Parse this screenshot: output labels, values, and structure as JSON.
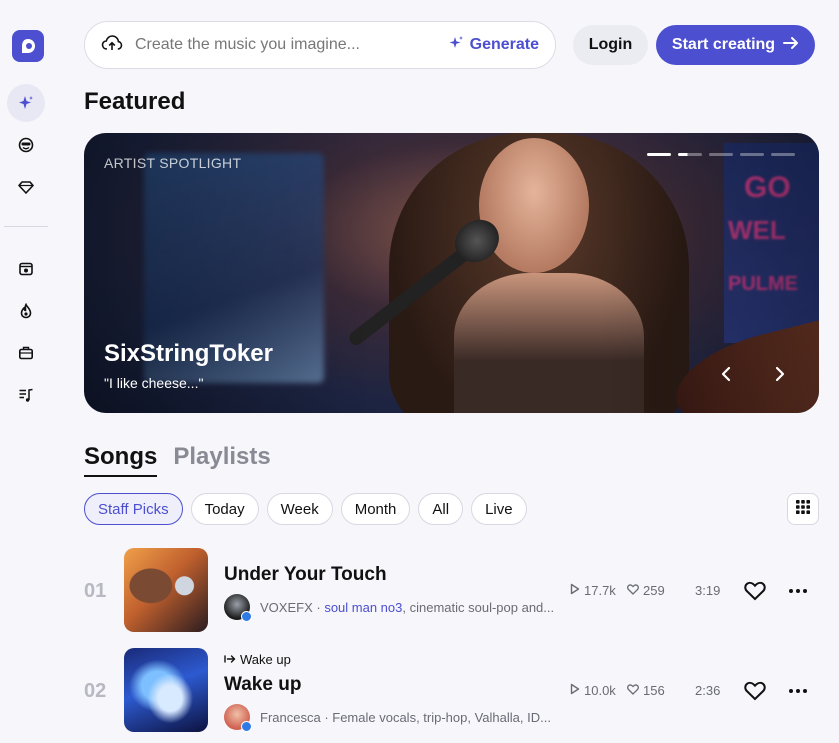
{
  "sidebar": {
    "logo_icon": "app-logo-icon",
    "items_top": [
      "sparkle-icon",
      "smiley-icon",
      "diamond-icon"
    ],
    "items_bottom": [
      "inbox-icon",
      "flame-icon",
      "briefcase-icon",
      "music-list-icon"
    ]
  },
  "search": {
    "placeholder": "Create the music you imagine...",
    "generate_label": "Generate"
  },
  "header": {
    "login_label": "Login",
    "start_label": "Start creating"
  },
  "featured": {
    "title": "Featured",
    "hero": {
      "label": "ARTIST SPOTLIGHT",
      "name": "SixStringToker",
      "quote": "\"I like cheese...\"",
      "slide_count": 5,
      "active_slide": 1
    }
  },
  "tabs": {
    "songs": "Songs",
    "playlists": "Playlists"
  },
  "filters": [
    "Staff Picks",
    "Today",
    "Week",
    "Month",
    "All",
    "Live"
  ],
  "songs": [
    {
      "rank": "01",
      "title": "Under Your Touch",
      "playlist_label": "",
      "artist": "VOXEFX",
      "artist_link": "soul man no3",
      "description": ", cinematic soul-pop and...",
      "plays": "17.7k",
      "likes": "259",
      "duration": "3:19"
    },
    {
      "rank": "02",
      "title": "Wake up",
      "playlist_label": "Wake up",
      "artist": "Francesca",
      "artist_link": "",
      "description": "Female vocals, trip-hop, Valhalla, ID...",
      "plays": "10.0k",
      "likes": "156",
      "duration": "2:36"
    }
  ],
  "colors": {
    "accent": "#4c4fcf",
    "background": "#f6f6fb",
    "verified": "#2f7ae5"
  }
}
